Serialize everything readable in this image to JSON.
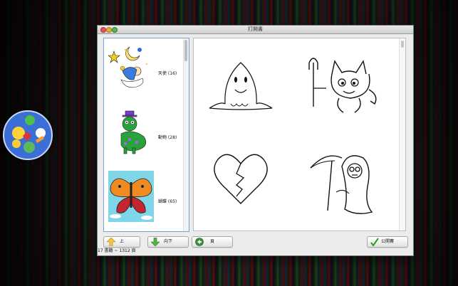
{
  "window": {
    "title": "打開書"
  },
  "books": [
    {
      "label": "天使 (16)",
      "icon": "angel-thumbnail"
    },
    {
      "label": "動物 (28)",
      "icon": "caterpillar-thumbnail"
    },
    {
      "label": "蝴蝶 (65)",
      "icon": "butterfly-thumbnail"
    }
  ],
  "pages": [
    {
      "icon": "ghost-drawing"
    },
    {
      "icon": "devil-drawing"
    },
    {
      "icon": "broken-heart-drawing"
    },
    {
      "icon": "grim-reaper-drawing"
    }
  ],
  "toolbar": {
    "up_label": "上",
    "down_label": "向下",
    "page_label": "頁",
    "open_label": "公開賽"
  },
  "status": {
    "text": "17 書籍 ~ 1312 頁"
  },
  "colors": {
    "accent_blue": "#3b6fd6",
    "sidebar_border": "#7aa0d6",
    "close": "#e2584f",
    "minimize": "#e3b23c",
    "maximize": "#59b94d"
  }
}
